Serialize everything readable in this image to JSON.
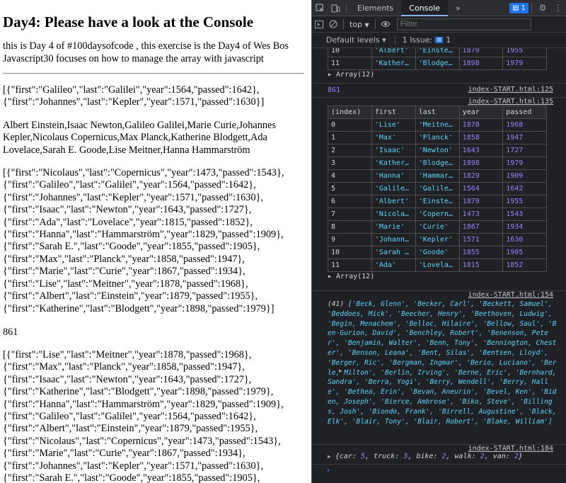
{
  "page": {
    "title": "Day4: Please have a look at the Console",
    "intro": "this is Day 4 of #100daysofcode , this exercise is the Day4 of Wes Bos Javascript30 focuses on how to manage the array with javascript",
    "block1": [
      "[{\"first\":\"Galileo\",\"last\":\"Galilei\",\"year\":1564,\"passed\":1642},",
      "{\"first\":\"Johannes\",\"last\":\"Kepler\",\"year\":1571,\"passed\":1630}]"
    ],
    "block2": [
      "Albert Einstein,Isaac Newton,Galileo Galilei,Marie Curie,Johannes",
      "Kepler,Nicolaus Copernicus,Max Planck,Katherine Blodgett,Ada",
      "Lovelace,Sarah E. Goode,Lise Meitner,Hanna Hammarström"
    ],
    "block3": [
      "[{\"first\":\"Nicolaus\",\"last\":\"Copernicus\",\"year\":1473,\"passed\":1543},",
      "{\"first\":\"Galileo\",\"last\":\"Galilei\",\"year\":1564,\"passed\":1642},",
      "{\"first\":\"Johannes\",\"last\":\"Kepler\",\"year\":1571,\"passed\":1630},",
      "{\"first\":\"Isaac\",\"last\":\"Newton\",\"year\":1643,\"passed\":1727},",
      "{\"first\":\"Ada\",\"last\":\"Lovelace\",\"year\":1815,\"passed\":1852},",
      "{\"first\":\"Hanna\",\"last\":\"Hammarström\",\"year\":1829,\"passed\":1909},",
      "{\"first\":\"Sarah E.\",\"last\":\"Goode\",\"year\":1855,\"passed\":1905},",
      "{\"first\":\"Max\",\"last\":\"Planck\",\"year\":1858,\"passed\":1947},",
      "{\"first\":\"Marie\",\"last\":\"Curie\",\"year\":1867,\"passed\":1934},",
      "{\"first\":\"Lise\",\"last\":\"Meitner\",\"year\":1878,\"passed\":1968},",
      "{\"first\":\"Albert\",\"last\":\"Einstein\",\"year\":1879,\"passed\":1955},",
      "{\"first\":\"Katherine\",\"last\":\"Blodgett\",\"year\":1898,\"passed\":1979}]"
    ],
    "total": "861",
    "block4": [
      "[{\"first\":\"Lise\",\"last\":\"Meitner\",\"year\":1878,\"passed\":1968},",
      "{\"first\":\"Max\",\"last\":\"Planck\",\"year\":1858,\"passed\":1947},",
      "{\"first\":\"Isaac\",\"last\":\"Newton\",\"year\":1643,\"passed\":1727},",
      "{\"first\":\"Katherine\",\"last\":\"Blodgett\",\"year\":1898,\"passed\":1979},",
      "{\"first\":\"Hanna\",\"last\":\"Hammarström\",\"year\":1829,\"passed\":1909},",
      "{\"first\":\"Galileo\",\"last\":\"Galilei\",\"year\":1564,\"passed\":1642},",
      "{\"first\":\"Albert\",\"last\":\"Einstein\",\"year\":1879,\"passed\":1955},",
      "{\"first\":\"Nicolaus\",\"last\":\"Copernicus\",\"year\":1473,\"passed\":1543},",
      "{\"first\":\"Marie\",\"last\":\"Curie\",\"year\":1867,\"passed\":1934},",
      "{\"first\":\"Johannes\",\"last\":\"Kepler\",\"year\":1571,\"passed\":1630},",
      "{\"first\":\"Sarah E.\",\"last\":\"Goode\",\"year\":1855,\"passed\":1905},"
    ]
  },
  "devtools": {
    "tabs": [
      "Elements",
      "Console"
    ],
    "active_tab": "Console",
    "more": "»",
    "badge_count": "1",
    "context": "top",
    "filter_placeholder": "Filter",
    "levels": "Default levels ▾",
    "issues": "1 Issue:",
    "issues_count": "1",
    "top_rows": [
      {
        "idx": "10",
        "first": "'Albert'",
        "last": "'Einste…",
        "year": "1879",
        "passed": "1955"
      },
      {
        "idx": "11",
        "first": "'Kather…",
        "last": "'Blodge…",
        "year": "1898",
        "passed": "1979"
      }
    ],
    "array_label": "▸ Array(12)",
    "num_log": "861",
    "src_125": "index-START.html:125",
    "src_135": "index-START.html:135",
    "src_154": "index-START.html:154",
    "src_184": "index-START.html:184",
    "table_headers": [
      "(index)",
      "first",
      "last",
      "year",
      "passed"
    ],
    "table_rows": [
      {
        "idx": "0",
        "first": "'Lise'",
        "last": "'Meitne…",
        "year": "1878",
        "passed": "1968"
      },
      {
        "idx": "1",
        "first": "'Max'",
        "last": "'Planck'",
        "year": "1858",
        "passed": "1947"
      },
      {
        "idx": "2",
        "first": "'Isaac'",
        "last": "'Newton'",
        "year": "1643",
        "passed": "1727"
      },
      {
        "idx": "3",
        "first": "'Kather…",
        "last": "'Blodge…",
        "year": "1898",
        "passed": "1979"
      },
      {
        "idx": "4",
        "first": "'Hanna'",
        "last": "'Hammar…",
        "year": "1829",
        "passed": "1909"
      },
      {
        "idx": "5",
        "first": "'Galile…",
        "last": "'Galile…",
        "year": "1564",
        "passed": "1642"
      },
      {
        "idx": "6",
        "first": "'Albert'",
        "last": "'Einste…",
        "year": "1879",
        "passed": "1955"
      },
      {
        "idx": "7",
        "first": "'Nicola…",
        "last": "'Copern…",
        "year": "1473",
        "passed": "1543"
      },
      {
        "idx": "8",
        "first": "'Marie'",
        "last": "'Curie'",
        "year": "1867",
        "passed": "1934"
      },
      {
        "idx": "9",
        "first": "'Johann…",
        "last": "'Kepler'",
        "year": "1571",
        "passed": "1630"
      },
      {
        "idx": "10",
        "first": "'Sarah …",
        "last": "'Goode'",
        "year": "1855",
        "passed": "1905"
      },
      {
        "idx": "11",
        "first": "'Ada'",
        "last": "'Lovela…",
        "year": "1815",
        "passed": "1852"
      }
    ],
    "people_count": "(41)",
    "people_text": " ['Beck, Glenn', 'Becker, Carl', 'Beckett, Samuel', 'Beddoes, Mick', 'Beecher, Henry', 'Beethoven, Ludwig', 'Begin, Menachem', 'Belloc, Hilaire', 'Bellow, Saul', 'Ben-Gurion, David', 'Benchley, Robert', 'Benenson, Peter', 'Benjamin, Walter', 'Benn, Tony', 'Bennington, Chester', 'Benson, Leana', 'Bent, Silas', 'Bentsen, Lloyd', 'Berger, Ric', 'Bergman, Ingmar', 'Berio, Luciano', 'Berle, Milton', 'Berlin, Irving', 'Berne, Eric', 'Bernhard, Sandra', 'Berra, Yogi', 'Berry, Wendell', 'Berry, Halle', 'Bethea, Erin', 'Bevan, Aneurin', 'Bevel, Ken', 'Biden, Joseph', 'Bierce, Ambrose', 'Biko, Steve', 'Billings, Josh', 'Biondo, Frank', 'Birrell, Augustine', 'Black, Elk', 'Blair, Tony', 'Blair, Robert', 'Blake, William']",
    "obj_open": "{",
    "obj": [
      {
        "k": "car",
        "v": "5"
      },
      {
        "k": "truck",
        "v": "3"
      },
      {
        "k": "bike",
        "v": "2"
      },
      {
        "k": "walk",
        "v": "2"
      },
      {
        "k": "van",
        "v": "2"
      }
    ],
    "obj_close": "}",
    "prompt": "›"
  }
}
